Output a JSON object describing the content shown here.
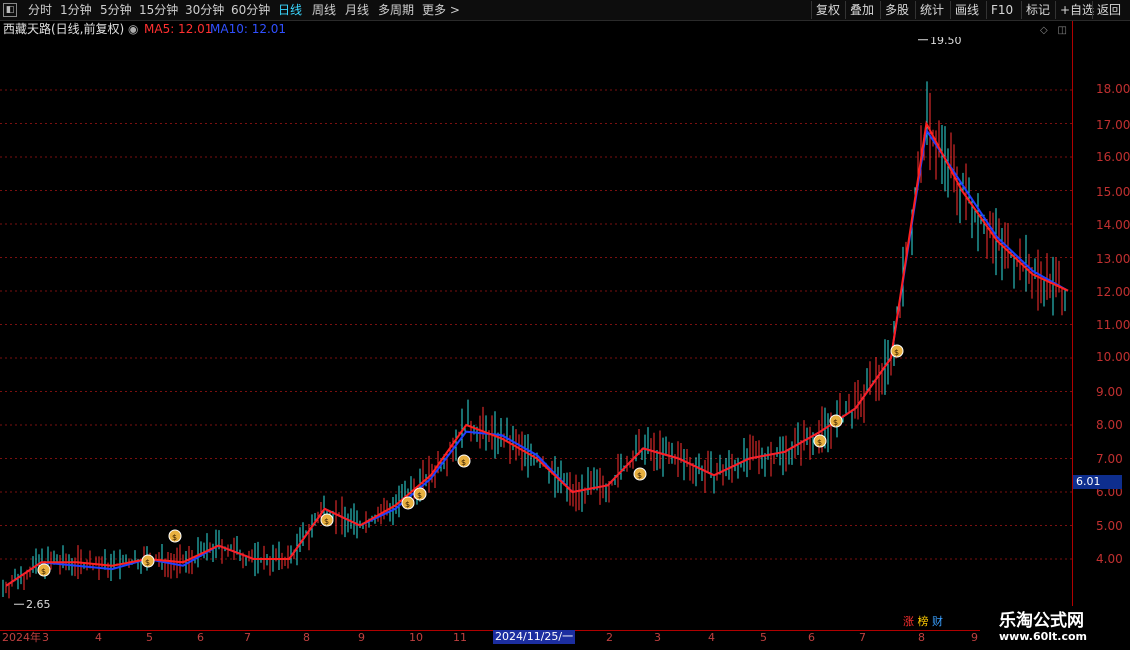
{
  "toolbar": {
    "left_tabs": [
      "分时",
      "1分钟",
      "5分钟",
      "15分钟",
      "30分钟",
      "60分钟",
      "日线",
      "周线",
      "月线",
      "多周期",
      "更多 >"
    ],
    "active_tab": "日线",
    "right_buttons": [
      "复权",
      "叠加",
      "多股",
      "统计",
      "画线",
      "F10",
      "标记",
      "+自选",
      "返回"
    ]
  },
  "info": {
    "title": "西藏天路(日线,前复权)",
    "ma5_label": "MA5: 12.01",
    "ma10_label": "MA10: 12.01"
  },
  "colors": {
    "up": "#ff3030",
    "down": "#30e0e0",
    "ma5": "#ff2020",
    "ma10": "#2040ff",
    "grid": "#7a1010",
    "axis": "#c03030"
  },
  "price_axis": {
    "ticks": [
      "18.00",
      "17.00",
      "16.00",
      "15.00",
      "14.00",
      "13.00",
      "12.00",
      "11.00",
      "10.00",
      "9.00",
      "8.00",
      "7.00",
      "6.00",
      "5.00",
      "4.00"
    ]
  },
  "chart_annotations": {
    "high": "19.50",
    "low": "2.65",
    "current_price": "6.01"
  },
  "date_axis": {
    "labels": [
      "2024年",
      "3",
      "4",
      "5",
      "6",
      "7",
      "8",
      "9",
      "10",
      "11",
      "2",
      "3",
      "4",
      "5",
      "6",
      "7",
      "8",
      "9"
    ],
    "cursor_date": "2024/11/25/一"
  },
  "bottom_icons": {
    "a": "涨",
    "b": "榜",
    "c": "财"
  },
  "watermark": {
    "line1": "乐淘公式网",
    "line2": "www.60lt.com"
  },
  "chart_data": {
    "type": "line",
    "title": "西藏天路(日线,前复权)",
    "x_labels": [
      "2024年",
      "3",
      "4",
      "5",
      "6",
      "7",
      "8",
      "9",
      "10",
      "11",
      "2024/11/25",
      "2",
      "3",
      "4",
      "5",
      "6",
      "7",
      "8",
      "9"
    ],
    "series": [
      {
        "name": "MA5",
        "values": [
          3.2,
          3.9,
          3.9,
          3.8,
          4.0,
          3.9,
          4.4,
          4.0,
          4.0,
          5.5,
          5.0,
          5.6,
          6.5,
          8.0,
          7.6,
          7.0,
          6.0,
          6.2,
          7.3,
          7.0,
          6.5,
          7.0,
          7.2,
          7.8,
          8.5,
          10.0,
          17.0,
          15.0,
          13.5,
          12.5,
          12.01
        ]
      },
      {
        "name": "MA10",
        "values": [
          3.2,
          3.9,
          3.8,
          3.7,
          4.0,
          3.8,
          4.4,
          4.0,
          4.0,
          5.5,
          5.0,
          5.5,
          6.4,
          7.8,
          7.7,
          7.1,
          6.0,
          6.2,
          7.3,
          7.0,
          6.5,
          7.0,
          7.2,
          7.8,
          8.5,
          10.0,
          16.8,
          15.2,
          13.6,
          12.6,
          12.01
        ]
      }
    ],
    "ylim": [
      3.0,
      19.6
    ],
    "high": 19.5,
    "low": 2.65
  }
}
